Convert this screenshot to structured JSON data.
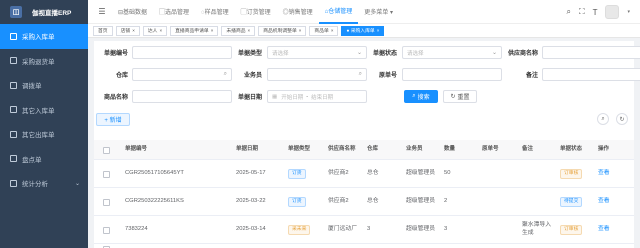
{
  "app": {
    "title": "伽视直播ERP"
  },
  "sidebar": {
    "items": [
      {
        "label": "采购入库单",
        "active": true
      },
      {
        "label": "采购退货单"
      },
      {
        "label": "调拨单"
      },
      {
        "label": "其它入库单"
      },
      {
        "label": "其它出库单"
      },
      {
        "label": "盘点单"
      },
      {
        "label": "统计分析",
        "caret": "⌄"
      }
    ]
  },
  "topmenu": {
    "items": [
      {
        "label": "⊟基础数据"
      },
      {
        "label": "▢选品管理"
      },
      {
        "label": "◌样品管理"
      },
      {
        "label": "▢订货管理"
      },
      {
        "label": "◎销售管理"
      },
      {
        "label": "⌂仓储管理",
        "active": true
      },
      {
        "label": "更多菜单 ▾"
      }
    ]
  },
  "tabs": [
    {
      "label": "首页"
    },
    {
      "label": "店铺",
      "close": "×"
    },
    {
      "label": "达人",
      "close": "×"
    },
    {
      "label": "直播商品申请单",
      "close": "×"
    },
    {
      "label": "未播商品",
      "close": "×"
    },
    {
      "label": "商品机制调整单",
      "close": "×"
    },
    {
      "label": "商品单",
      "close": "×"
    },
    {
      "label": "● 采购入库单",
      "close": "×",
      "active": true
    }
  ],
  "filters": {
    "doc_no_label": "单据编号",
    "doc_type_label": "单据类型",
    "doc_type_placeholder": "请选择",
    "doc_status_label": "单据状态",
    "doc_status_placeholder": "请选择",
    "supplier_label": "供应商名称",
    "warehouse_label": "仓库",
    "salesman_label": "业务员",
    "origin_no_label": "原单号",
    "remark_label": "备注",
    "product_name_label": "商品名称",
    "doc_date_label": "单据日期",
    "start_date_placeholder": "开始日期",
    "date_separator": "-",
    "end_date_placeholder": "结束日期",
    "search_label": "搜索",
    "reset_label": "重置"
  },
  "toolbar": {
    "add_label": "+ 新增"
  },
  "table": {
    "headers": [
      "单据编号",
      "单据日期",
      "单据类型",
      "供应商名称",
      "仓库",
      "业务员",
      "数量",
      "原单号",
      "备注",
      "单据状态",
      "操作"
    ],
    "rows": [
      {
        "doc_no": "CGR25051710564​5YT",
        "date": "2025-05-17",
        "type": "订货",
        "type_color": "blue",
        "supplier": "供应商2",
        "warehouse": "总仓",
        "salesman": "超级管理员",
        "qty": "50",
        "origin": "",
        "remark": "",
        "status": "订审核",
        "status_color": "orange",
        "action": "查看"
      },
      {
        "doc_no": "CGR25032222​5611KS",
        "date": "2025-03-22",
        "type": "订货",
        "type_color": "blue",
        "supplier": "供应商2",
        "warehouse": "总仓",
        "salesman": "超级管理员",
        "qty": "2",
        "origin": "",
        "remark": "",
        "status": "待提交",
        "status_color": "blue",
        "action": "查看"
      },
      {
        "doc_no": "7383224",
        "date": "2025-03-14",
        "type": "采未来",
        "type_color": "orange",
        "supplier": "厦门远动厂",
        "warehouse": "3",
        "salesman": "超级管理员",
        "qty": "3",
        "origin": "",
        "remark": "聚水潭导入生成",
        "status": "订审核",
        "status_color": "orange",
        "action": "查看"
      }
    ]
  }
}
